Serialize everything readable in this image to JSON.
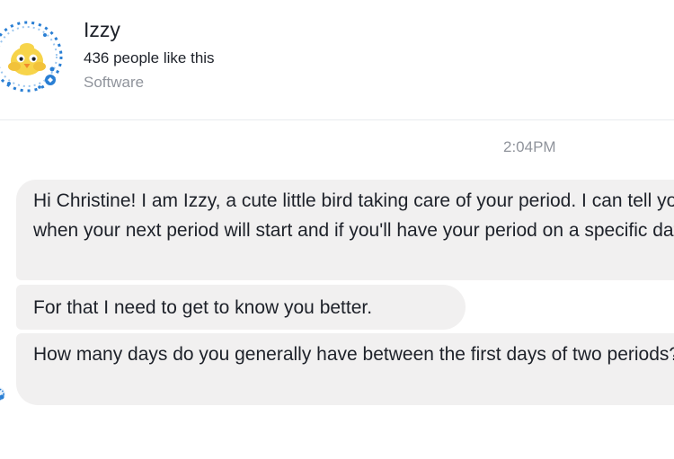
{
  "profile": {
    "name": "Izzy",
    "likes": "436 people like this",
    "category": "Software",
    "avatar_icon": "bird-icon"
  },
  "conversation": {
    "timestamp": "2:04PM",
    "messages": [
      {
        "text": "Hi Christine! I am Izzy, a cute little bird taking care of your period. I can tell you when your next period will start and if you'll have your period on a specific date."
      },
      {
        "text": "For that I need to get to know you better."
      },
      {
        "text": "How many days do you generally have between the first days of two periods?"
      }
    ]
  },
  "colors": {
    "bubble_background": "#f1f0f0",
    "text_primary": "#1d2129",
    "text_secondary": "#90949c",
    "avatar_accent": "#2a7fd4",
    "bird_yellow": "#f7d44a"
  }
}
